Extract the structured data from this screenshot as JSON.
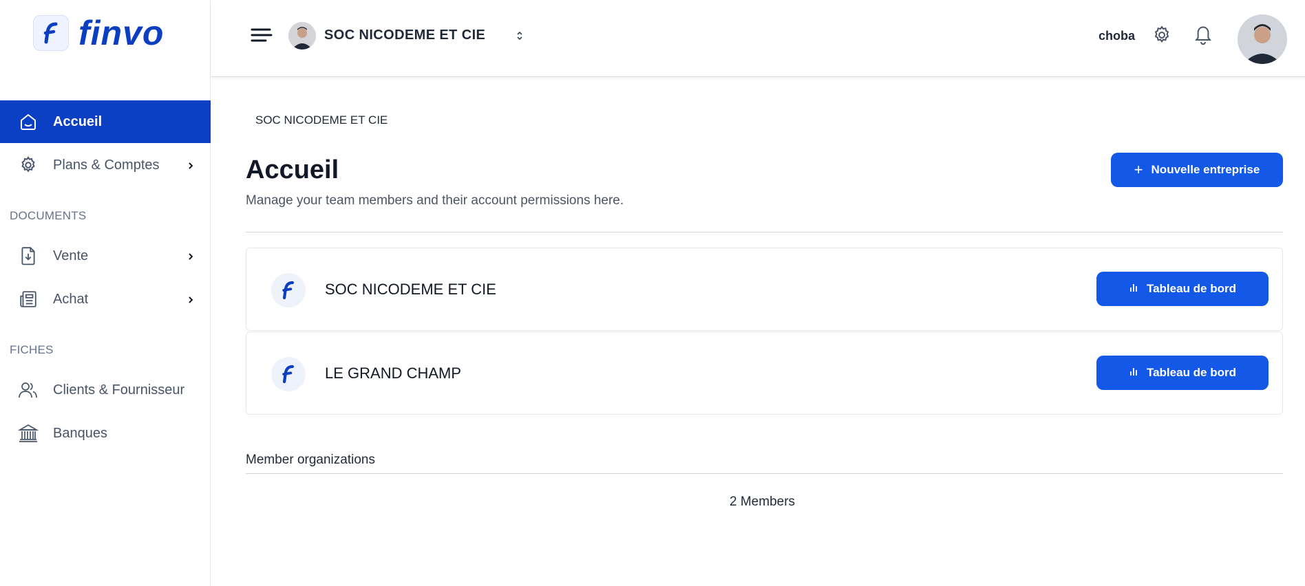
{
  "brand": {
    "name": "finvo",
    "color": "#0b3fbf"
  },
  "sidebar": {
    "items": [
      {
        "label": "Accueil",
        "icon": "home-icon",
        "active": true
      },
      {
        "label": "Plans & Comptes",
        "icon": "gear-icon",
        "has_submenu": true
      }
    ],
    "sections": [
      {
        "title": "DOCUMENTS",
        "items": [
          {
            "label": "Vente",
            "icon": "document-download-icon",
            "has_submenu": true
          },
          {
            "label": "Achat",
            "icon": "newspaper-icon",
            "has_submenu": true
          }
        ]
      },
      {
        "title": "FICHES",
        "items": [
          {
            "label": "Clients & Fournisseur",
            "icon": "users-icon"
          },
          {
            "label": "Banques",
            "icon": "bank-icon"
          }
        ]
      }
    ]
  },
  "header": {
    "organization": "SOC NICODEME ET CIE",
    "username": "choba"
  },
  "main": {
    "breadcrumb": "SOC NICODEME ET CIE",
    "title": "Accueil",
    "subtitle": "Manage your team members and their account permissions here.",
    "new_button": "Nouvelle entreprise",
    "companies": [
      {
        "name": "SOC NICODEME ET CIE",
        "action": "Tableau de bord"
      },
      {
        "name": "LE GRAND CHAMP",
        "action": "Tableau de bord"
      }
    ],
    "members_label": "Member organizations",
    "members_count": "2 Members"
  },
  "colors": {
    "primary": "#0b40c4",
    "button": "#1358e6"
  }
}
